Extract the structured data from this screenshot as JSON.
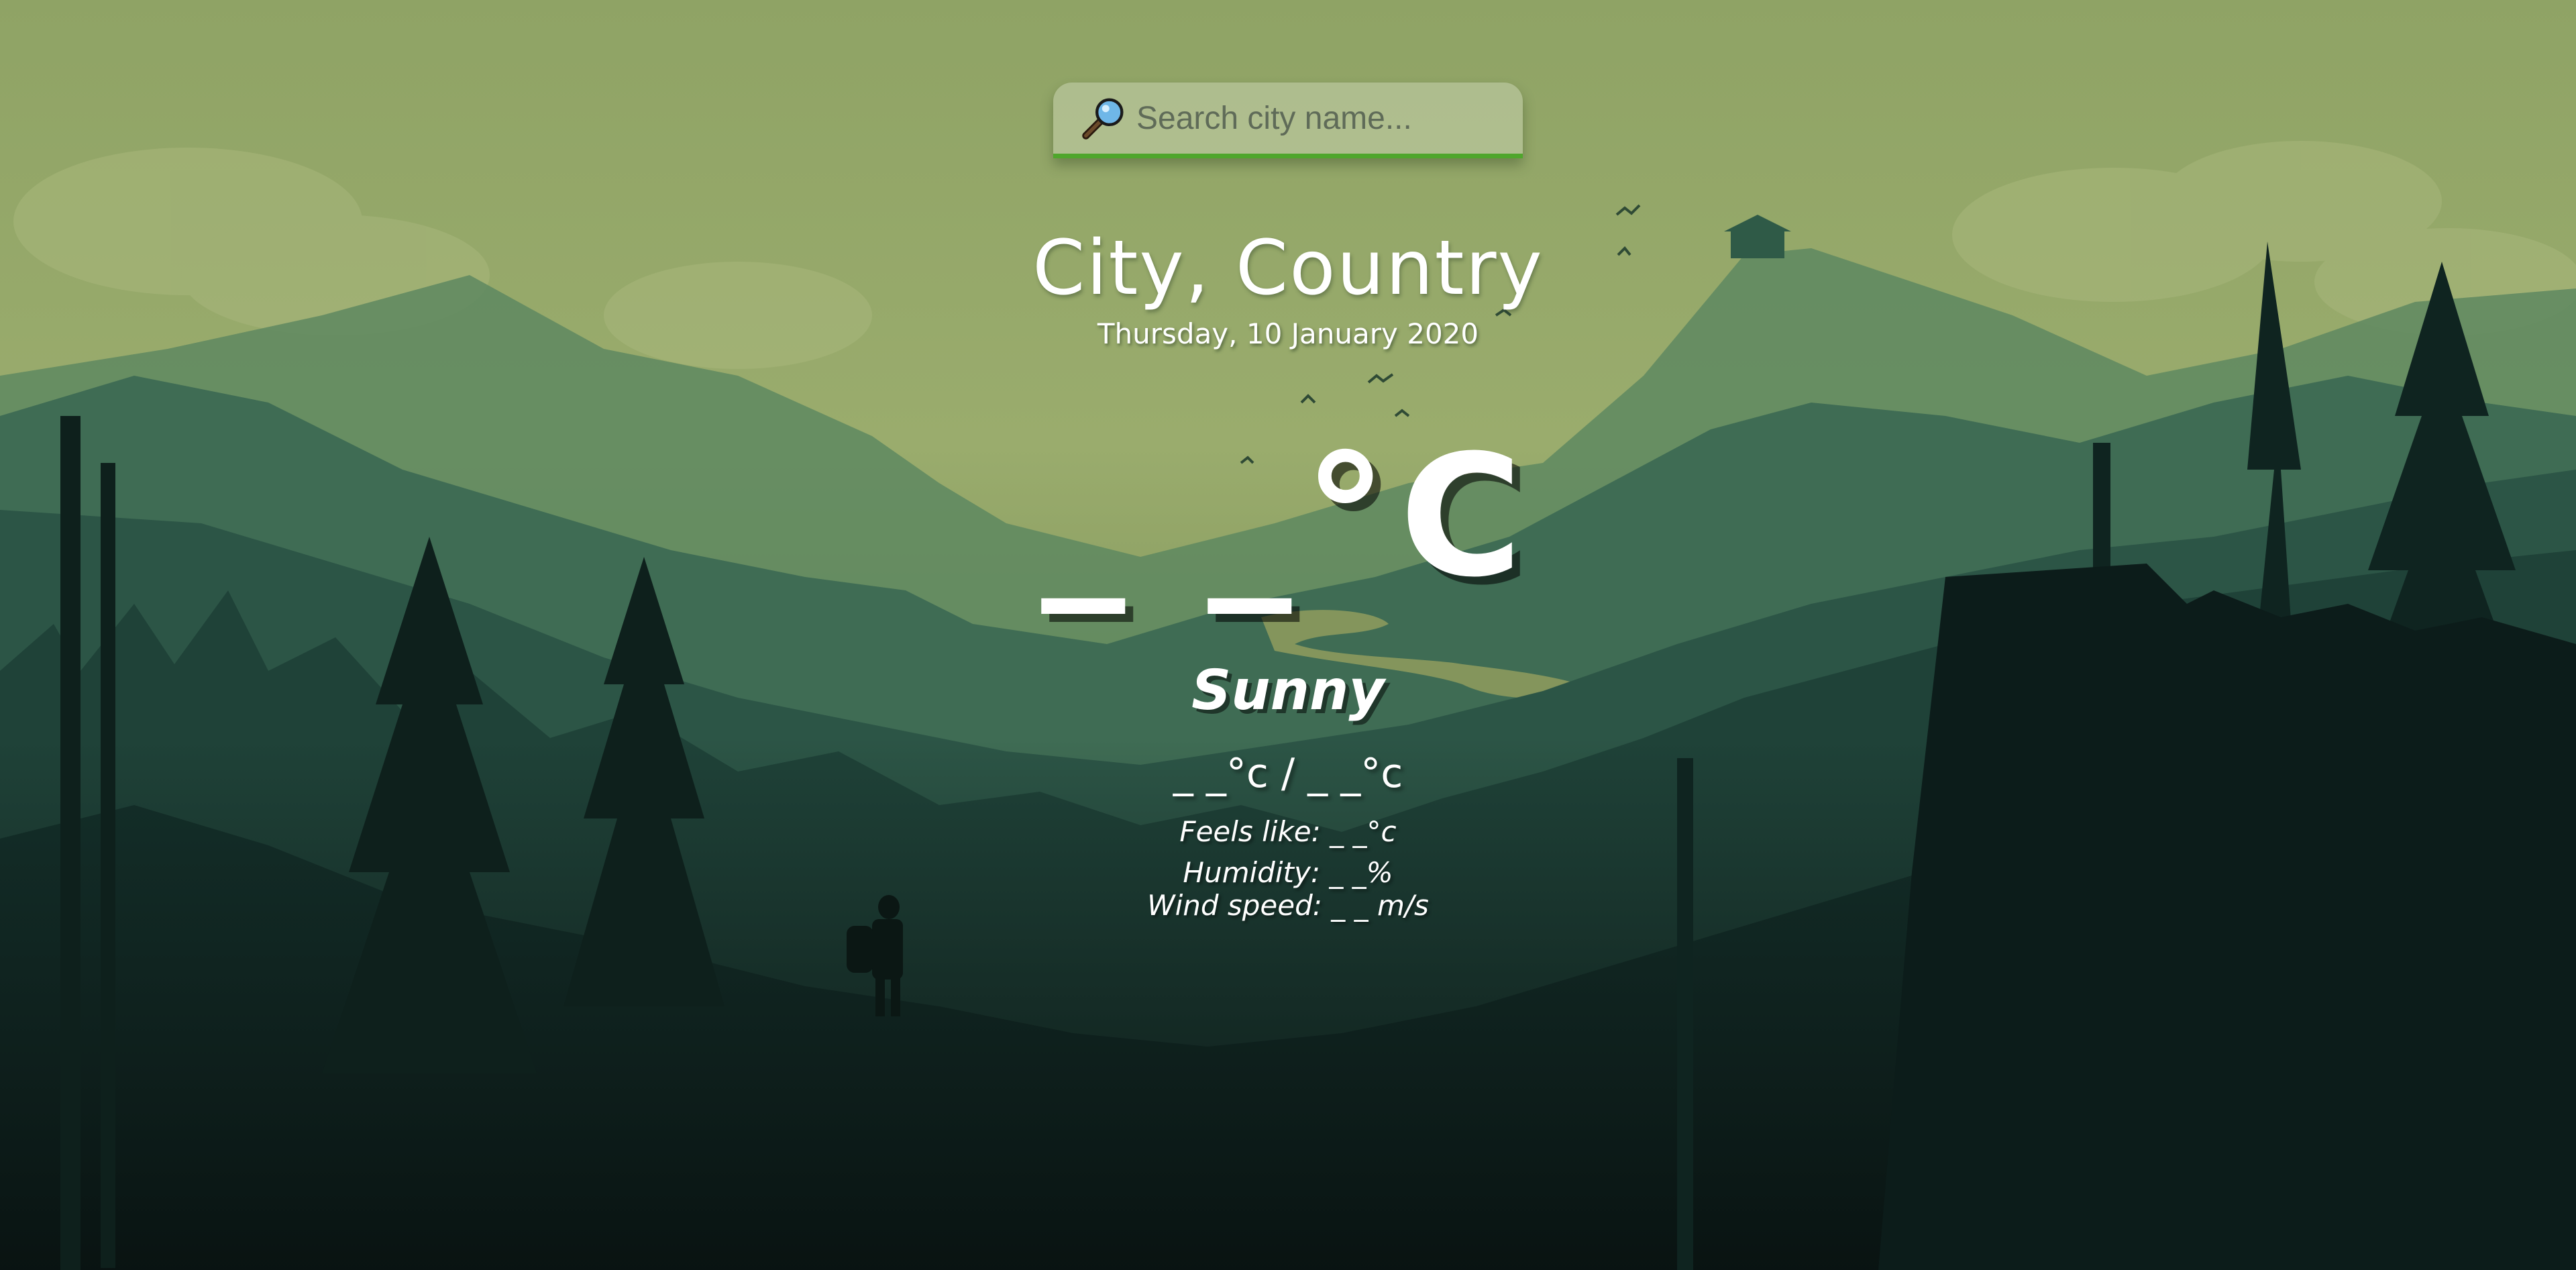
{
  "search": {
    "placeholder": "Search city name...",
    "value": "",
    "icon": "search-icon"
  },
  "location": {
    "name": "City, Country",
    "date": "Thursday, 10 January 2020"
  },
  "weather": {
    "temperature": "_ _°C",
    "condition": "Sunny",
    "hi_lo": "_ _°c / _ _°c",
    "feels_like": "Feels like: _ _°c",
    "humidity": "Humidity: _ _%",
    "wind_speed": "Wind speed: _ _ m/s"
  },
  "colors": {
    "sky": "#93a56a",
    "search_underline": "#4fa62c",
    "forest_dark": "#0b1414"
  }
}
